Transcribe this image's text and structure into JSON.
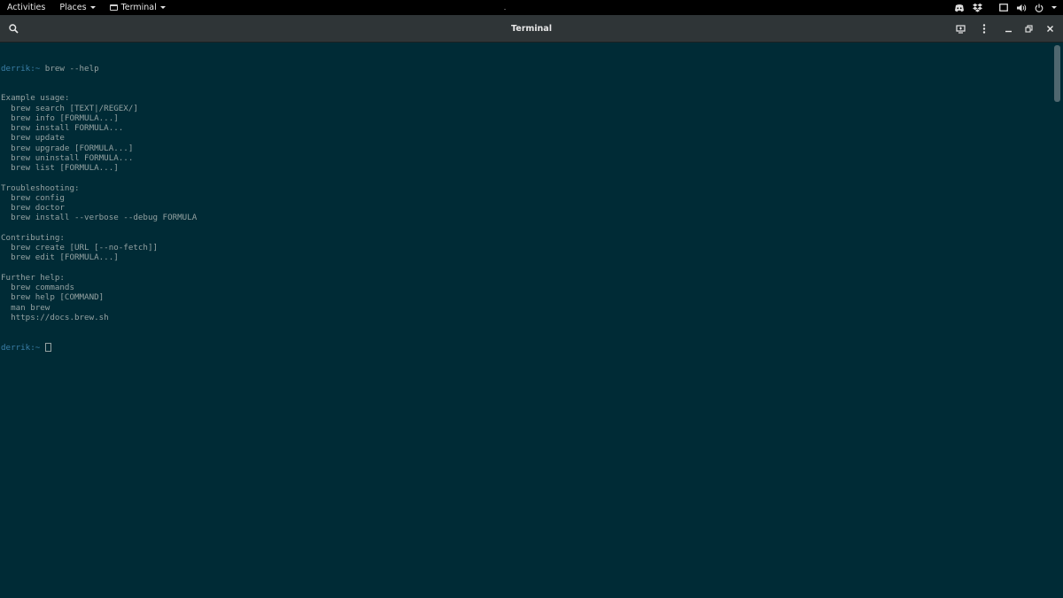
{
  "topbar": {
    "activities": "Activities",
    "places": "Places",
    "app_menu": "Terminal",
    "tray_icons": [
      "discord-icon",
      "dropbox-icon",
      "screen-icon",
      "volume-icon",
      "power-icon"
    ]
  },
  "window": {
    "title": "Terminal",
    "header_icons": [
      "search-icon",
      "new-tab-icon",
      "menu-icon",
      "minimize-icon",
      "maximize-icon",
      "close-icon"
    ]
  },
  "terminal": {
    "prompt": "derrik:~",
    "command": " brew --help",
    "output": [
      "Example usage:",
      "  brew search [TEXT|/REGEX/]",
      "  brew info [FORMULA...]",
      "  brew install FORMULA...",
      "  brew update",
      "  brew upgrade [FORMULA...]",
      "  brew uninstall FORMULA...",
      "  brew list [FORMULA...]",
      "",
      "Troubleshooting:",
      "  brew config",
      "  brew doctor",
      "  brew install --verbose --debug FORMULA",
      "",
      "Contributing:",
      "  brew create [URL [--no-fetch]]",
      "  brew edit [FORMULA...]",
      "",
      "Further help:",
      "  brew commands",
      "  brew help [COMMAND]",
      "  man brew",
      "  https://docs.brew.sh"
    ],
    "final_prompt": "derrik:~",
    "colors": {
      "background": "#002b36",
      "foreground": "#93a1a1",
      "prompt": "#3a7fa8"
    }
  }
}
